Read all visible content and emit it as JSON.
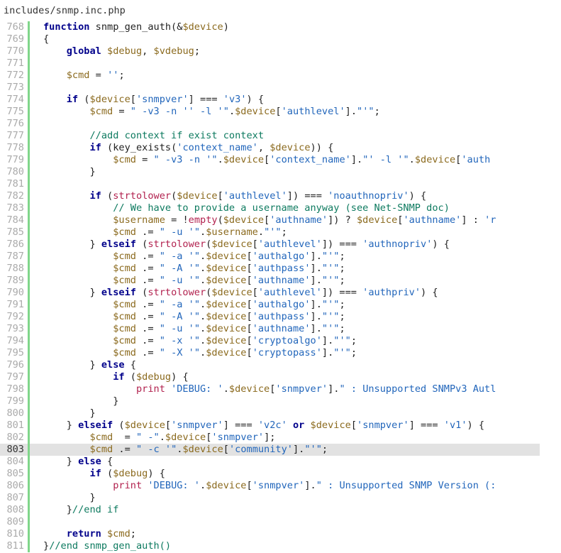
{
  "file": {
    "path": "includes/snmp.inc.php"
  },
  "current_line": 803,
  "lines": [
    {
      "n": "768",
      "code": "<k>function</k> snmp_gen_auth(&<v>$device</v>)"
    },
    {
      "n": "769",
      "code": "{"
    },
    {
      "n": "770",
      "code": "    <k>global</k> <v>$debug</v>, <v>$vdebug</v>;"
    },
    {
      "n": "771",
      "code": ""
    },
    {
      "n": "772",
      "code": "    <v>$cmd</v> = <s>''</s>;"
    },
    {
      "n": "773",
      "code": ""
    },
    {
      "n": "774",
      "code": "    <k>if</k> (<v>$device</v>[<s>'snmpver'</s>] === <s>'v3'</s>) {"
    },
    {
      "n": "775",
      "code": "        <v>$cmd</v> = <s>\" -v3 -n '' -l '\"</s>.<v>$device</v>[<s>'authlevel'</s>].<s>\"'\"</s>;"
    },
    {
      "n": "776",
      "code": ""
    },
    {
      "n": "777",
      "code": "        <c>//add context if exist context</c>"
    },
    {
      "n": "778",
      "code": "        <k>if</k> (key_exists(<s>'context_name'</s>, <v>$device</v>)) {"
    },
    {
      "n": "779",
      "code": "            <v>$cmd</v> = <s>\" -v3 -n '\"</s>.<v>$device</v>[<s>'context_name'</s>].<s>\"' -l '\"</s>.<v>$device</v>[<s>'auth</s>"
    },
    {
      "n": "780",
      "code": "        }"
    },
    {
      "n": "781",
      "code": ""
    },
    {
      "n": "782",
      "code": "        <k>if</k> (<f>strtolower</f>(<v>$device</v>[<s>'authlevel'</s>]) === <s>'noauthnopriv'</s>) {"
    },
    {
      "n": "783",
      "code": "            <c>// We have to provide a username anyway (see Net-SNMP doc)</c>"
    },
    {
      "n": "784",
      "code": "            <v>$username</v> = !<f>empty</f>(<v>$device</v>[<s>'authname'</s>]) ? <v>$device</v>[<s>'authname'</s>] : <s>'r</s>"
    },
    {
      "n": "785",
      "code": "            <v>$cmd</v> .= <s>\" -u '\"</s>.<v>$username</v>.<s>\"'\"</s>;"
    },
    {
      "n": "786",
      "code": "        } <k>elseif</k> (<f>strtolower</f>(<v>$device</v>[<s>'authlevel'</s>]) === <s>'authnopriv'</s>) {"
    },
    {
      "n": "787",
      "code": "            <v>$cmd</v> .= <s>\" -a '\"</s>.<v>$device</v>[<s>'authalgo'</s>].<s>\"'\"</s>;"
    },
    {
      "n": "788",
      "code": "            <v>$cmd</v> .= <s>\" -A '\"</s>.<v>$device</v>[<s>'authpass'</s>].<s>\"'\"</s>;"
    },
    {
      "n": "789",
      "code": "            <v>$cmd</v> .= <s>\" -u '\"</s>.<v>$device</v>[<s>'authname'</s>].<s>\"'\"</s>;"
    },
    {
      "n": "790",
      "code": "        } <k>elseif</k> (<f>strtolower</f>(<v>$device</v>[<s>'authlevel'</s>]) === <s>'authpriv'</s>) {"
    },
    {
      "n": "791",
      "code": "            <v>$cmd</v> .= <s>\" -a '\"</s>.<v>$device</v>[<s>'authalgo'</s>].<s>\"'\"</s>;"
    },
    {
      "n": "792",
      "code": "            <v>$cmd</v> .= <s>\" -A '\"</s>.<v>$device</v>[<s>'authpass'</s>].<s>\"'\"</s>;"
    },
    {
      "n": "793",
      "code": "            <v>$cmd</v> .= <s>\" -u '\"</s>.<v>$device</v>[<s>'authname'</s>].<s>\"'\"</s>;"
    },
    {
      "n": "794",
      "code": "            <v>$cmd</v> .= <s>\" -x '\"</s>.<v>$device</v>[<s>'cryptoalgo'</s>].<s>\"'\"</s>;"
    },
    {
      "n": "795",
      "code": "            <v>$cmd</v> .= <s>\" -X '\"</s>.<v>$device</v>[<s>'cryptopass'</s>].<s>\"'\"</s>;"
    },
    {
      "n": "796",
      "code": "        } <k>else</k> {"
    },
    {
      "n": "797",
      "code": "            <k>if</k> (<v>$debug</v>) {"
    },
    {
      "n": "798",
      "code": "                <f>print</f> <s>'DEBUG: '</s>.<v>$device</v>[<s>'snmpver'</s>].<s>\" : Unsupported SNMPv3 Autl</s>"
    },
    {
      "n": "799",
      "code": "            }"
    },
    {
      "n": "800",
      "code": "        }"
    },
    {
      "n": "801",
      "code": "    } <k>elseif</k> (<v>$device</v>[<s>'snmpver'</s>] === <s>'v2c'</s> <k>or</k> <v>$device</v>[<s>'snmpver'</s>] === <s>'v1'</s>) {"
    },
    {
      "n": "802",
      "code": "        <v>$cmd</v>  = <s>\" -\"</s>.<v>$device</v>[<s>'snmpver'</s>];"
    },
    {
      "n": "803",
      "code": "        <v>$cmd</v> .= <s>\" -c '\"</s>.<v>$device</v>[<s>'community'</s>].<s>\"'\"</s>;"
    },
    {
      "n": "804",
      "code": "    } <k>else</k> {"
    },
    {
      "n": "805",
      "code": "        <k>if</k> (<v>$debug</v>) {"
    },
    {
      "n": "806",
      "code": "            <f>print</f> <s>'DEBUG: '</s>.<v>$device</v>[<s>'snmpver'</s>].<s>\" : Unsupported SNMP Version (:</s>"
    },
    {
      "n": "807",
      "code": "        }"
    },
    {
      "n": "808",
      "code": "    }<c>//end if</c>"
    },
    {
      "n": "809",
      "code": ""
    },
    {
      "n": "810",
      "code": "    <k>return</k> <v>$cmd</v>;"
    },
    {
      "n": "811",
      "code": "}<c>//end snmp_gen_auth()</c>"
    }
  ]
}
